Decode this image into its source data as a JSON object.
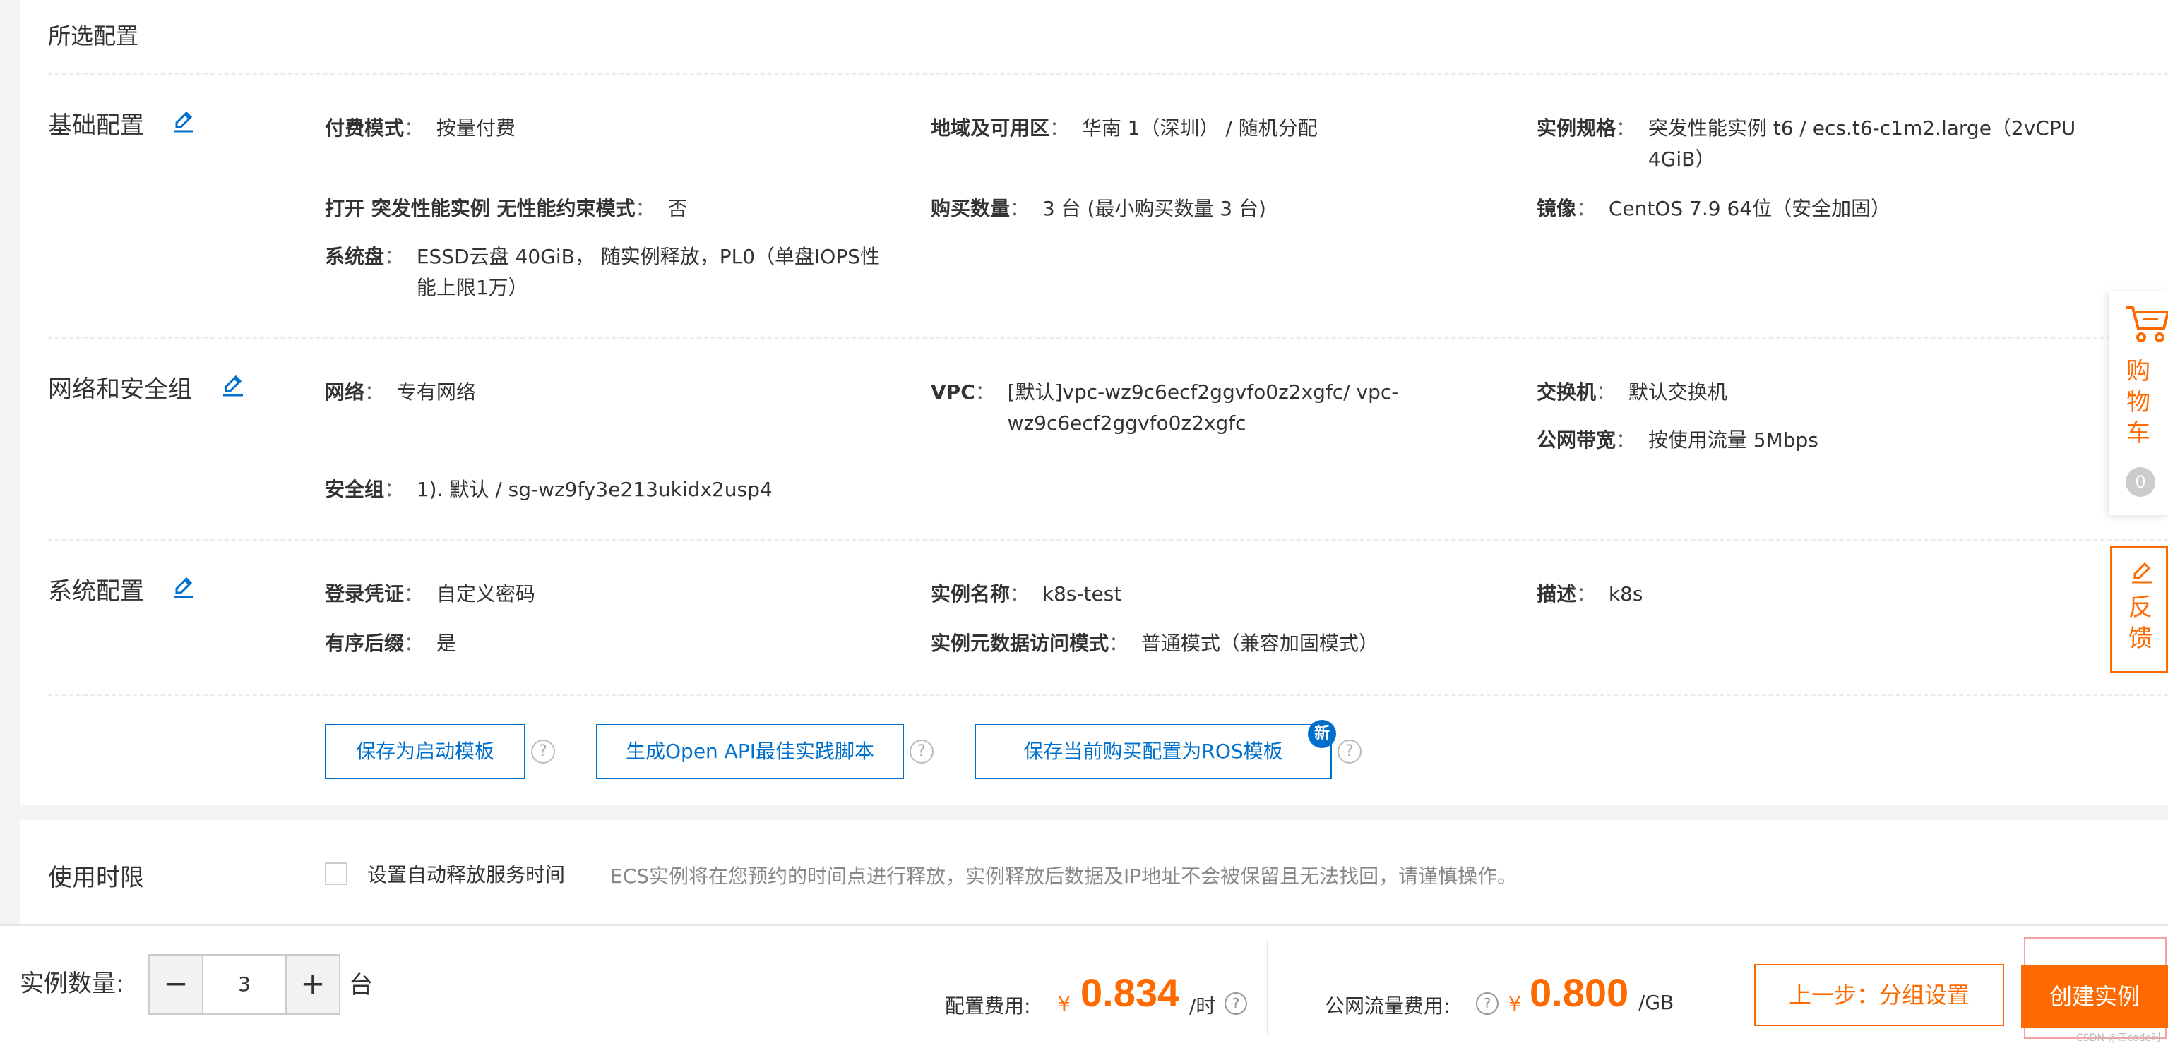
{
  "selected_config": {
    "title": "所选配置",
    "basic": {
      "title": "基础配置",
      "billing": {
        "label": "付费模式",
        "value": "按量付费"
      },
      "region": {
        "label": "地域及可用区",
        "value": "华南 1（深圳） / 随机分配"
      },
      "spec": {
        "label": "实例规格",
        "value_line1": "突发性能实例 t6 / ecs.t6-c1m2.large（2vCPU",
        "value_line2": "4GiB）"
      },
      "burst": {
        "label": "打开 突发性能实例 无性能约束模式",
        "value": "否"
      },
      "quantity": {
        "label": "购买数量",
        "value": "3 台 (最小购买数量 3 台)"
      },
      "image": {
        "label": "镜像",
        "value": "CentOS 7.9 64位（安全加固）"
      },
      "system_disk": {
        "label": "系统盘",
        "value_line1": "ESSD云盘 40GiB， 随实例释放，PL0（单盘IOPS性",
        "value_line2": "能上限1万）"
      }
    },
    "network": {
      "title": "网络和安全组",
      "network": {
        "label": "网络",
        "value": "专有网络"
      },
      "vpc": {
        "label": "VPC",
        "value_line1": "[默认]vpc-wz9c6ecf2ggvfo0z2xgfc/ vpc-",
        "value_line2": "wz9c6ecf2ggvfo0z2xgfc"
      },
      "vswitch": {
        "label": "交换机",
        "value": "默认交换机"
      },
      "bandwidth": {
        "label": "公网带宽",
        "value": "按使用流量 5Mbps"
      },
      "security_group": {
        "label": "安全组",
        "value": "1). 默认 / sg-wz9fy3e213ukidx2usp4"
      }
    },
    "system": {
      "title": "系统配置",
      "credential": {
        "label": "登录凭证",
        "value": "自定义密码"
      },
      "instance_name": {
        "label": "实例名称",
        "value": "k8s-test"
      },
      "description": {
        "label": "描述",
        "value": "k8s"
      },
      "suffix": {
        "label": "有序后缀",
        "value": "是"
      },
      "metadata": {
        "label": "实例元数据访问模式",
        "value": "普通模式（兼容加固模式）"
      }
    },
    "actions": {
      "save_template": "保存为启动模板",
      "openapi": "生成Open API最佳实践脚本",
      "ros": "保存当前购买配置为ROS模板",
      "new_badge": "新",
      "help": "?"
    }
  },
  "duration": {
    "title": "使用时限",
    "checkbox_label": "设置自动释放服务时间",
    "description": "ECS实例将在您预约的时间点进行释放，实例释放后数据及IP地址不会被保留且无法找回，请谨慎操作。"
  },
  "footer": {
    "qty_label": "实例数量:",
    "qty_value": "3",
    "qty_unit": "台",
    "config_fee_label": "配置费用:",
    "currency": "¥",
    "config_fee": "0.834",
    "config_fee_unit": "/时",
    "traffic_fee_label": "公网流量费用:",
    "traffic_fee": "0.800",
    "traffic_fee_unit": "/GB",
    "prev_button": "上一步：分组设置",
    "create_button": "创建实例",
    "watermark": "CSDN @四code时",
    "help": "?"
  },
  "floating": {
    "cart": [
      "购",
      "物",
      "车"
    ],
    "cart_count": "0",
    "feedback": [
      "反",
      "馈"
    ]
  },
  "colors": {
    "accent": "#ff6a00",
    "link": "#0070cc"
  },
  "icons": [
    "edit-icon",
    "help-icon",
    "cart-icon",
    "feedback-icon",
    "minus-icon",
    "plus-icon"
  ]
}
